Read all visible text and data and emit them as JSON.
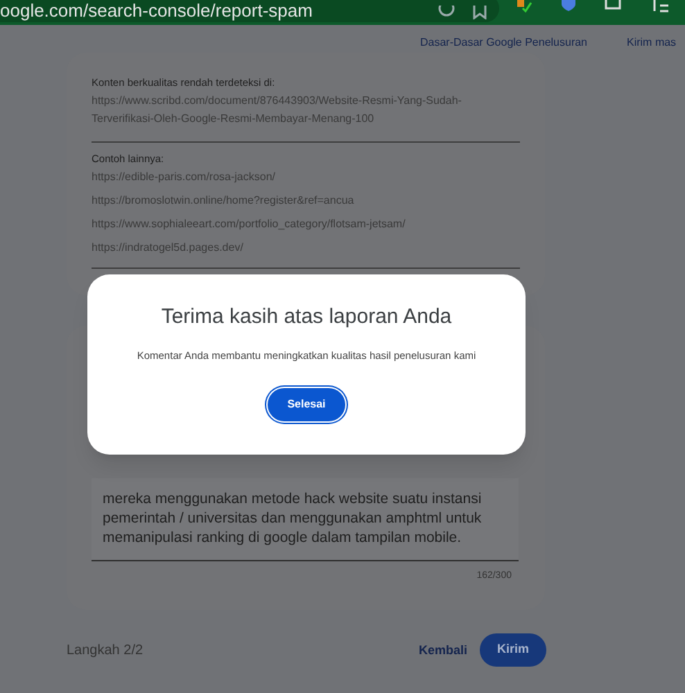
{
  "browser": {
    "address": "oogle.com/search-console/report-spam"
  },
  "top_links": [
    "Dasar-Dasar Google Penelusuran",
    "Kirim mas"
  ],
  "report": {
    "detected_label": "Konten berkualitas rendah terdeteksi di:",
    "detected_url": "https://www.scribd.com/document/876443903/Website-Resmi-Yang-Sudah-Terverifikasi-Oleh-Google-Resmi-Membayar-Menang-100",
    "examples_label": "Contoh lainnya:",
    "examples": [
      "https://edible-paris.com/rosa-jackson/",
      "https://bromoslotwin.online/home?register&ref=ancua",
      "https://www.sophialeeart.com/portfolio_category/flotsam-jetsam/",
      "https://indratogel5d.pages.dev/"
    ]
  },
  "comment": {
    "value": "mereka menggunakan metode hack website suatu instansi pemerintah / universitas dan menggunakan amphtml untuk memanipulasi ranking di google dalam tampilan mobile.",
    "counter": "162/300"
  },
  "footer": {
    "step": "Langkah 2/2",
    "back": "Kembali",
    "submit": "Kirim"
  },
  "dialog": {
    "title": "Terima kasih atas laporan Anda",
    "message": "Komentar Anda membantu meningkatkan kualitas hasil penelusuran kami",
    "button": "Selesai"
  }
}
